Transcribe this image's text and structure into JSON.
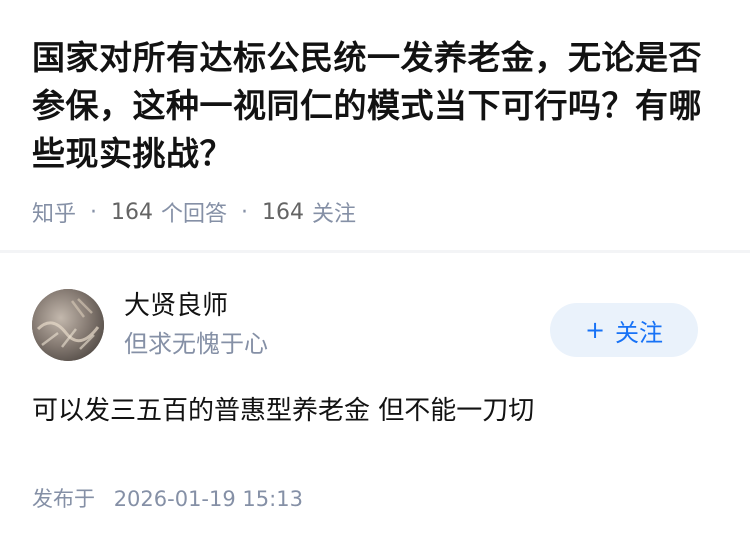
{
  "question": {
    "title": "国家对所有达标公民统一发养老金，无论是否参保，这种一视同仁的模式当下可行吗？有哪些现实挑战？",
    "source": "知乎",
    "separator": "·",
    "answer_count": "164",
    "answer_label": "个回答",
    "follow_count": "164",
    "follow_label": "关注"
  },
  "answer": {
    "author_name": "大贤良师",
    "author_bio": "但求无愧于心",
    "follow_button": {
      "icon": "plus-icon",
      "plus": "+",
      "label": "关注"
    },
    "content": "可以发三五百的普惠型养老金 但不能一刀切",
    "published_label": "发布于",
    "published_time": "2026-01-19 15:13"
  },
  "colors": {
    "text": "#121212",
    "meta": "#8590a6",
    "accent": "#1772f6",
    "button_bg": "#eaf2fb"
  }
}
